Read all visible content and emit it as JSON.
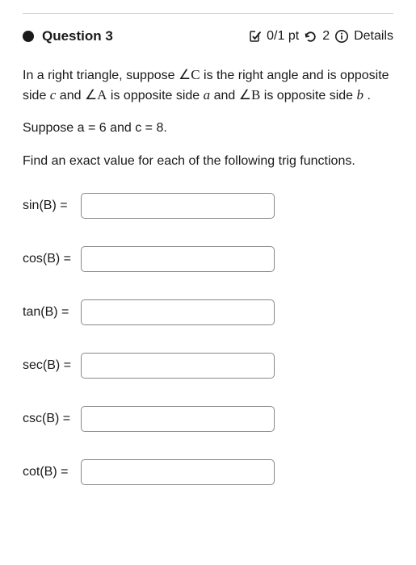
{
  "header": {
    "question_title": "Question 3",
    "points_text": "0/1 pt",
    "attempts_text": "2",
    "details_label": "Details"
  },
  "problem": {
    "intro_pre": "In a right triangle, suppose ",
    "angle_c": "∠C",
    "intro_mid1": " is the right angle and is opposite side ",
    "side_c": "c",
    "intro_mid2": "  and ",
    "angle_a": "∠A",
    "intro_mid3": " is opposite side ",
    "side_a": "a",
    "intro_mid4": " and ",
    "angle_b": "∠B",
    "intro_mid5": "  is opposite side ",
    "side_b": "b",
    "intro_end": " .",
    "given": "Suppose a = 6 and c = 8.",
    "instruction": "Find an exact value for each of the following trig functions."
  },
  "inputs": {
    "sin_label": "sin(B) =",
    "cos_label": "cos(B) =",
    "tan_label": "tan(B) =",
    "sec_label": "sec(B) =",
    "csc_label": "csc(B) =",
    "cot_label": "cot(B) =",
    "sin_value": "",
    "cos_value": "",
    "tan_value": "",
    "sec_value": "",
    "csc_value": "",
    "cot_value": ""
  }
}
